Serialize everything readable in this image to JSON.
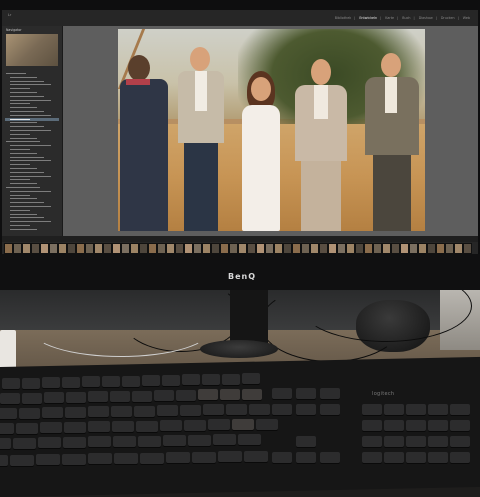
{
  "monitor": {
    "brand": "BenQ"
  },
  "lightroom": {
    "modules": [
      "Bibliothek",
      "Entwickeln",
      "Karte",
      "Buch",
      "Diashow",
      "Drucken",
      "Web"
    ],
    "active_module": "Entwickeln",
    "left_panel_title": "Navigator",
    "colors": {
      "panel_bg": "#2b2b2b",
      "selected_row": "#5b6b79",
      "photo_warm": "#c79454"
    }
  },
  "keyboard": {
    "brand": "logitech"
  }
}
